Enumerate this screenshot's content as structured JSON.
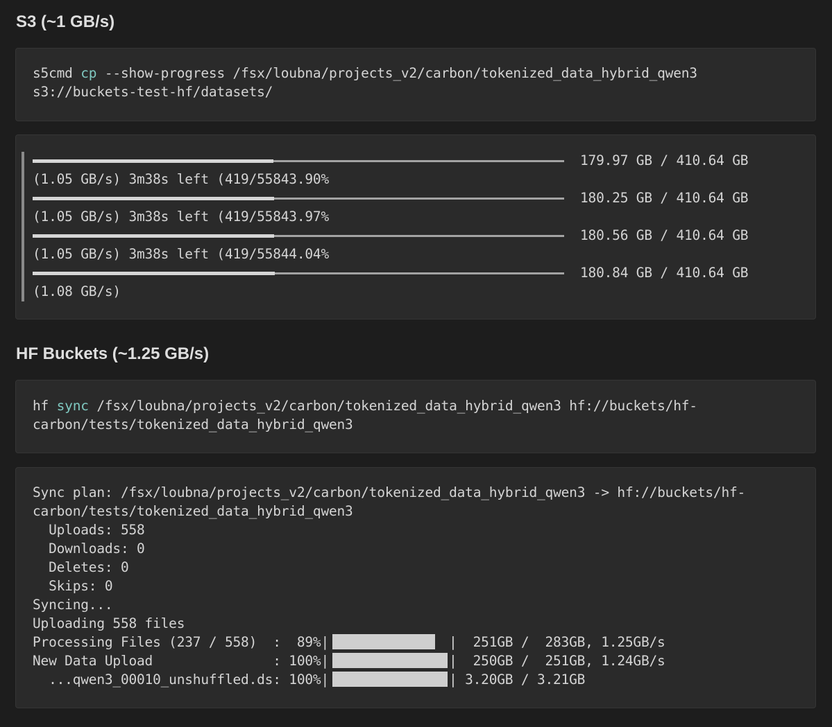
{
  "s3": {
    "heading": "S3 (~1 GB/s)",
    "command": {
      "line1_prefix": "s5cmd ",
      "line1_kw": "cp",
      "line1_rest": " --show-progress /fsx/loubna/projects_v2/carbon/tokenized_data_hybrid_qwen3",
      "line2": "s3://buckets-test-hf/datasets/"
    },
    "progress": [
      {
        "size": "179.97 GB / 410.64 GB",
        "status": "(1.05 GB/s) 3m38s left (419/55843.90%",
        "fraction": 0.4383
      },
      {
        "size": "180.25 GB / 410.64 GB",
        "status": "(1.05 GB/s) 3m38s left (419/55843.97%",
        "fraction": 0.439
      },
      {
        "size": "180.56 GB / 410.64 GB",
        "status": "(1.05 GB/s) 3m38s left (419/55844.04%",
        "fraction": 0.4397
      },
      {
        "size": "180.84 GB / 410.64 GB",
        "status": "(1.08 GB/s)",
        "fraction": 0.4404
      }
    ]
  },
  "hf": {
    "heading": "HF Buckets (~1.25 GB/s)",
    "command": {
      "line1_prefix": "hf ",
      "line1_kw": "sync",
      "line1_rest": " /fsx/loubna/projects_v2/carbon/tokenized_data_hybrid_qwen3 hf://buckets/hf-",
      "line2": "carbon/tests/tokenized_data_hybrid_qwen3"
    },
    "output": {
      "plan_line1": "Sync plan: /fsx/loubna/projects_v2/carbon/tokenized_data_hybrid_qwen3 -> hf://buckets/hf-",
      "plan_line2": "carbon/tests/tokenized_data_hybrid_qwen3",
      "uploads": "  Uploads: 558",
      "downloads": "  Downloads: 0",
      "deletes": "  Deletes: 0",
      "skips": "  Skips: 0",
      "syncing": "Syncing...",
      "uploading": "Uploading 558 files",
      "bars": [
        {
          "label": "Processing Files (237 / 558)  :  89%|",
          "tail": "|  251GB /  283GB, 1.25GB/s",
          "percent": 89
        },
        {
          "label": "New Data Upload               : 100%|",
          "tail": "|  250GB /  251GB, 1.24GB/s",
          "percent": 100
        },
        {
          "label": "  ...qwen3_00010_unshuffled.ds: 100%|",
          "tail": "| 3.20GB / 3.21GB",
          "percent": 100
        }
      ]
    }
  }
}
